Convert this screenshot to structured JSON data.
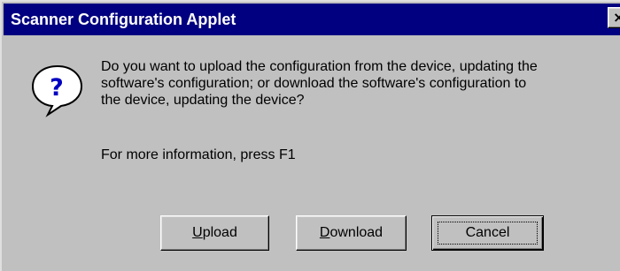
{
  "window": {
    "title": "Scanner Configuration Applet",
    "close_glyph": "×",
    "colors": {
      "face": "#c0c0c0",
      "titlebar": "#000080",
      "title_text": "#ffffff"
    }
  },
  "dialog": {
    "icon": "question-icon",
    "icon_glyph": "?",
    "message": "Do you want to upload the configuration from the device, updating the\nsoftware's configuration; or download the software's configuration to\nthe device, updating the device?",
    "info": "For more information, press F1"
  },
  "buttons": {
    "upload": {
      "mnemonic": "U",
      "rest": "pload"
    },
    "download": {
      "mnemonic": "D",
      "rest": "ownload"
    },
    "cancel": {
      "label": "Cancel",
      "default": true
    }
  }
}
